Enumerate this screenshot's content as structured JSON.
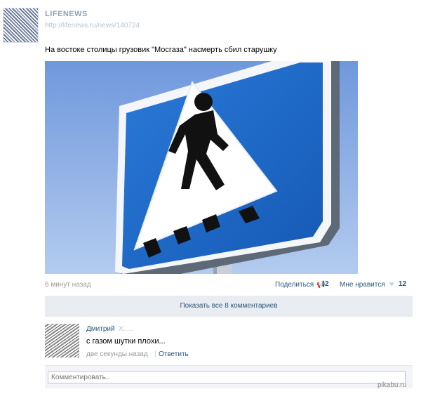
{
  "post": {
    "group_name": "LIFENEWS",
    "source_link": "http://lifenews.ru/news/140724",
    "text": "На востоке столицы грузовик \"Мосгаза\" насмерть сбил старушку",
    "photo": {
      "subject": "pedestrian-crossing-sign-icon",
      "sky_color": "#8fb2e6",
      "sign_color": "#1f6fd0"
    }
  },
  "meta": {
    "time": "6 минут назад",
    "share_label": "Поделиться",
    "share_count": "2",
    "like_label": "Мне нравится",
    "like_count": "12"
  },
  "comments": {
    "show_all_label": "Показать все 8 комментариев",
    "items": [
      {
        "author_first": "Дмитрий",
        "author_last": "Х.....",
        "text": "с газом шутки плохи...",
        "time": "две секунды назад",
        "reply_label": "Ответить"
      }
    ],
    "input_placeholder": "Комментировать.."
  },
  "watermark": "pikabu.ru",
  "colors": {
    "link": "#2b587a",
    "muted": "#999999",
    "bar": "#e9edf1"
  }
}
